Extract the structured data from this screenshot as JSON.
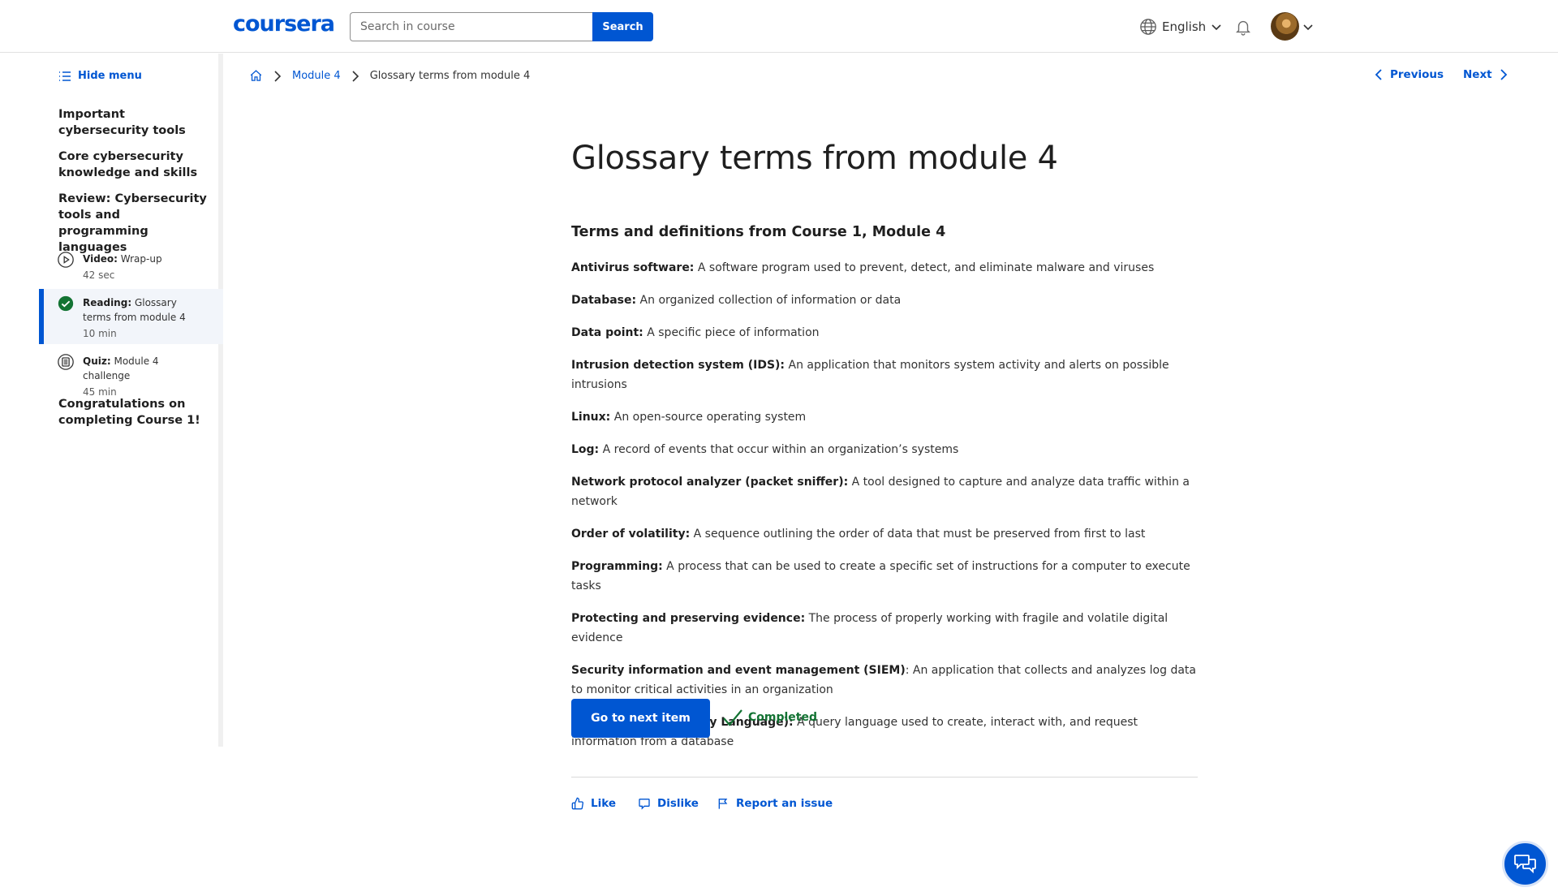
{
  "header": {
    "logo": "coursera",
    "search_placeholder": "Search in course",
    "search_button": "Search",
    "language": "English"
  },
  "sidebar": {
    "hide_menu": "Hide menu",
    "headings": [
      "Important cybersecurity tools",
      "Core cybersecurity knowledge and skills",
      "Review: Cybersecurity tools and programming languages"
    ],
    "items": [
      {
        "type": "Video:",
        "title": "Wrap-up",
        "duration": "42 sec",
        "icon": "play-circle-icon"
      },
      {
        "type": "Reading:",
        "title": "Glossary terms from module 4",
        "duration": "10 min",
        "icon": "check-circle-icon"
      },
      {
        "type": "Quiz:",
        "title": "Module 4 challenge",
        "duration": "45 min",
        "icon": "quiz-icon"
      }
    ],
    "last_heading": "Congratulations on completing Course 1!"
  },
  "breadcrumb": {
    "module": "Module 4",
    "current": "Glossary terms from module 4"
  },
  "nav": {
    "previous": "Previous",
    "next": "Next"
  },
  "main": {
    "title": "Glossary terms from module 4",
    "section_title": "Terms and definitions from Course 1, Module 4",
    "terms": [
      {
        "name": "Antivirus software:",
        "def": " A software program used to prevent, detect, and eliminate malware and viruses"
      },
      {
        "name": "Database:",
        "def": " An organized collection of information or data"
      },
      {
        "name": "Data point:",
        "def": " A specific piece of information"
      },
      {
        "name": "Intrusion detection system (IDS):",
        "def": " An application that monitors system activity and alerts on possible intrusions"
      },
      {
        "name": "Linux:",
        "def": " An open-source operating system"
      },
      {
        "name": "Log:",
        "def": " A record of events that occur within an organization’s systems"
      },
      {
        "name": "Network protocol analyzer (packet sniffer):",
        "def": " A tool designed to capture and analyze data traffic within a network"
      },
      {
        "name": "Order of volatility:",
        "def": " A sequence outlining the order of data that must be preserved from first to last"
      },
      {
        "name": "Programming:",
        "def": " A process that can be used to create a specific set of instructions for a computer to execute tasks"
      },
      {
        "name": "Protecting and preserving evidence:",
        "def": " The process of properly working with fragile and volatile digital evidence"
      },
      {
        "name": "Security information and event management (SIEM)",
        "def": ": An application that collects and analyzes log data to monitor critical activities in an organization"
      },
      {
        "name": "SQL (Structured Query Language):",
        "def": " A query language used to create, interact with, and request information from a database"
      }
    ],
    "next_button": "Go to next item",
    "completed": "Completed",
    "feedback": {
      "like": "Like",
      "dislike": "Dislike",
      "report": "Report an issue"
    }
  },
  "colors": {
    "brand": "#0056d2",
    "success": "#137333"
  }
}
